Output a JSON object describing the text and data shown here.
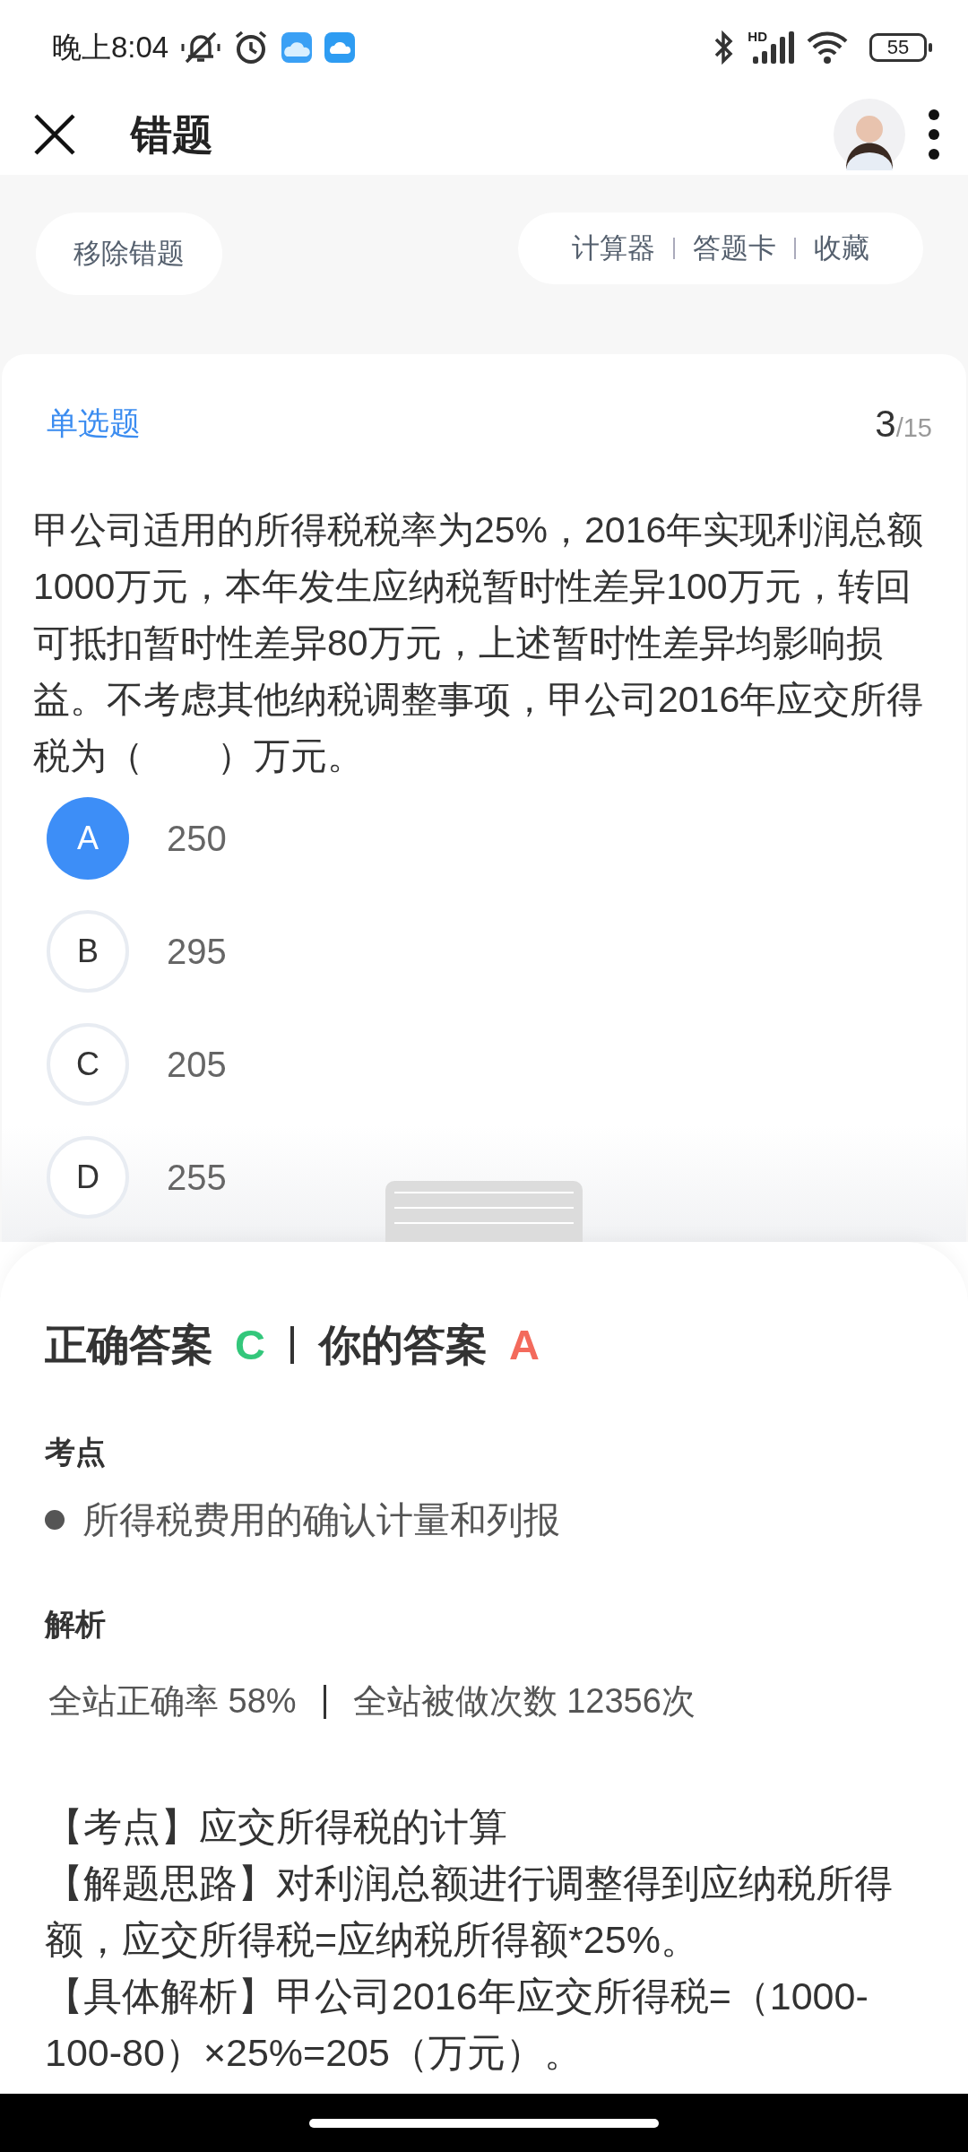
{
  "status_bar": {
    "time": "晚上8:04",
    "network": "HD",
    "battery": "55"
  },
  "app_bar": {
    "title": "错题"
  },
  "toolbar": {
    "remove_button": "移除错题",
    "tools": [
      "计算器",
      "答题卡",
      "收藏"
    ]
  },
  "question": {
    "type": "单选题",
    "index": "3",
    "total": "/15",
    "text": "甲公司适用的所得税税率为25%，2016年实现利润总额1000万元，本年发生应纳税暂时性差异100万元，转回可抵扣暂时性差异80万元，上述暂时性差异均影响损益。不考虑其他纳税调整事项，甲公司2016年应交所得税为（　　）万元。",
    "options": [
      {
        "letter": "A",
        "value": "250",
        "selected": true
      },
      {
        "letter": "B",
        "value": "295",
        "selected": false
      },
      {
        "letter": "C",
        "value": "205",
        "selected": false
      },
      {
        "letter": "D",
        "value": "255",
        "selected": false
      }
    ]
  },
  "answer_sheet": {
    "correct_label": "正确答案",
    "correct_answer": "C",
    "your_label": "你的答案",
    "your_answer": "A",
    "point_heading": "考点",
    "points": [
      "所得税费用的确认计量和列报"
    ],
    "analysis_heading": "解析",
    "stats": [
      "全站正确率 58%",
      "全站被做次数 12356次"
    ],
    "explanation": [
      "【考点】应交所得税的计算",
      "【解题思路】对利润总额进行调整得到应纳税所得额，应交所得税=应纳税所得额*25%。",
      "【具体解析】甲公司2016年应交所得税=（1000-100-80）×25%=205（万元）。"
    ]
  }
}
